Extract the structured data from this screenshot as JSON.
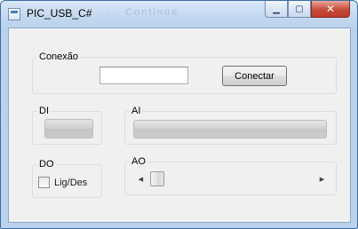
{
  "window": {
    "title": "PIC_USB_C#",
    "ghost_toolbar_text": "· · ·   Continue",
    "minimize_glyph": "▁",
    "maximize_glyph": "▢",
    "close_glyph": "✕"
  },
  "conexao": {
    "label": "Conexão",
    "port_value": "",
    "connect_button": "Conectar"
  },
  "di": {
    "label": "DI",
    "state": "off"
  },
  "ai": {
    "label": "AI",
    "value_fraction": 0
  },
  "do": {
    "label": "DO",
    "checkbox_label": "Lig/Des",
    "checked": false
  },
  "ao": {
    "label": "AO",
    "left_arrow": "◀",
    "right_arrow": "▶",
    "value_fraction": 0
  },
  "colors": {
    "client_bg": "#f0f0f0",
    "titlebar": "#c3d8f0",
    "close_red": "#c74a3a"
  }
}
